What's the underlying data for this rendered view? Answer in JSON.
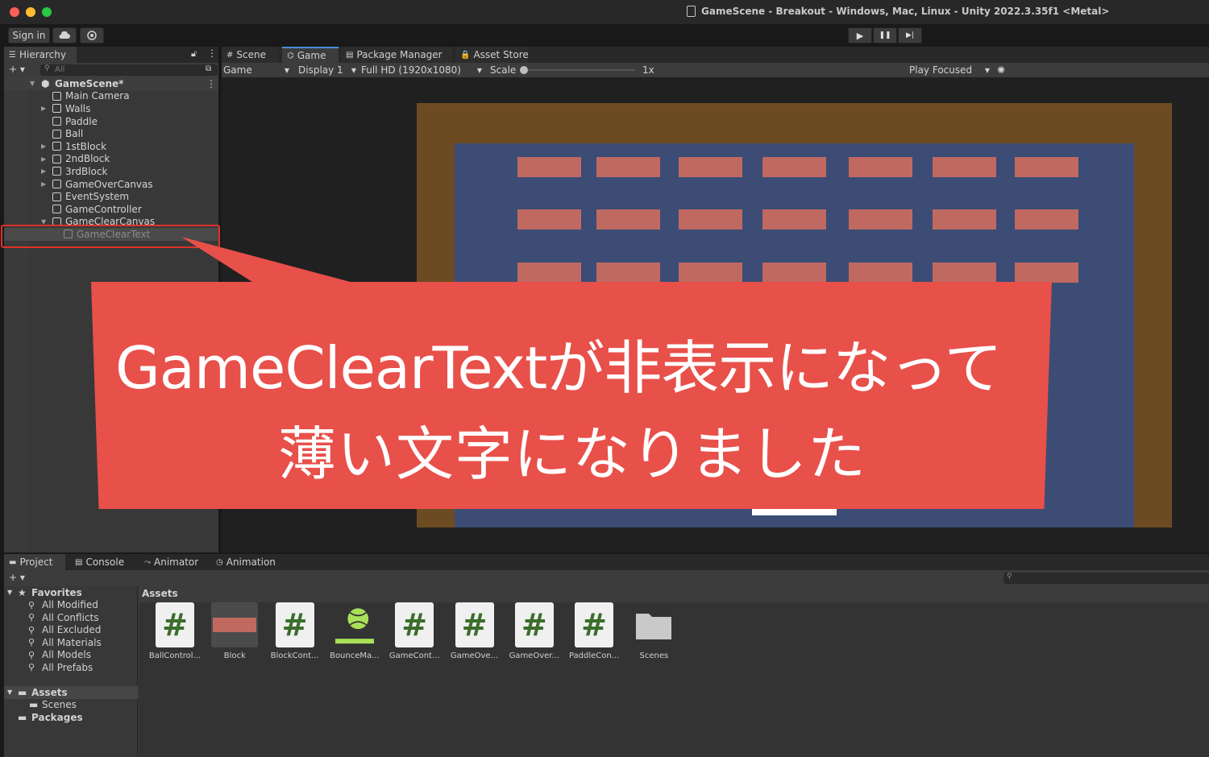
{
  "window": {
    "title": "GameScene - Breakout - Windows, Mac, Linux - Unity 2022.3.35f1 <Metal>"
  },
  "toolbar": {
    "sign_in_label": "Sign in",
    "cloud_icon": "cloud-icon",
    "collab_icon": "collab-icon",
    "play_icon": "▶",
    "pause_icon": "❚❚",
    "step_icon": "▶|"
  },
  "hierarchy": {
    "tab_label": "Hierarchy",
    "add_label": "+ ▾",
    "search_placeholder": "All",
    "scene_name": "GameScene*",
    "items": [
      {
        "label": "Main Camera",
        "expandable": false
      },
      {
        "label": "Walls",
        "expandable": true
      },
      {
        "label": "Paddle",
        "expandable": false
      },
      {
        "label": "Ball",
        "expandable": false
      },
      {
        "label": "1stBlock",
        "expandable": true
      },
      {
        "label": "2ndBlock",
        "expandable": true
      },
      {
        "label": "3rdBlock",
        "expandable": true
      },
      {
        "label": "GameOverCanvas",
        "expandable": true
      },
      {
        "label": "EventSystem",
        "expandable": false
      },
      {
        "label": "GameController",
        "expandable": false
      },
      {
        "label": "GameClearCanvas",
        "expandable": true,
        "expanded": true
      },
      {
        "label": "GameClearText",
        "expandable": false,
        "inactive": true,
        "highlighted": true
      }
    ]
  },
  "editor_tabs": [
    {
      "label": "Scene",
      "icon": "#"
    },
    {
      "label": "Game",
      "icon": "⌬",
      "active": true
    },
    {
      "label": "Package Manager",
      "icon": "▤"
    },
    {
      "label": "Asset Store",
      "icon": "🔒"
    }
  ],
  "game_toolbar": {
    "display_mode": "Game",
    "display": "Display 1",
    "resolution": "Full HD (1920x1080)",
    "scale_label": "Scale",
    "scale_value": "1x",
    "play_mode": "Play Focused"
  },
  "game": {
    "colors": {
      "wall": "#6d4b22",
      "field": "#3c4c75",
      "block": "#c06961",
      "paddle": "#ffffff"
    },
    "block_rows": 3,
    "block_cols": 7
  },
  "project_tabs": [
    {
      "label": "Project",
      "icon": "▬",
      "active": true
    },
    {
      "label": "Console",
      "icon": "▤"
    },
    {
      "label": "Animator",
      "icon": "⤳"
    },
    {
      "label": "Animation",
      "icon": "◷"
    }
  ],
  "project": {
    "favorites_label": "Favorites",
    "favorites": [
      "All Modified",
      "All Conflicts",
      "All Excluded",
      "All Materials",
      "All Models",
      "All Prefabs"
    ],
    "assets_label": "Assets",
    "assets_children": [
      "Scenes"
    ],
    "packages_label": "Packages",
    "breadcrumb": "Assets",
    "items": [
      {
        "name": "BallControl...",
        "kind": "script"
      },
      {
        "name": "Block",
        "kind": "prefab"
      },
      {
        "name": "BlockCont...",
        "kind": "script"
      },
      {
        "name": "BounceMa...",
        "kind": "physics-material"
      },
      {
        "name": "GameCont...",
        "kind": "script"
      },
      {
        "name": "GameOve...",
        "kind": "script"
      },
      {
        "name": "GameOver...",
        "kind": "script"
      },
      {
        "name": "PaddleCon...",
        "kind": "script"
      },
      {
        "name": "Scenes",
        "kind": "folder"
      }
    ]
  },
  "callout": {
    "line1": "GameClearTextが非表示になって",
    "line2": "薄い文字になりました",
    "color": "#e8504a"
  }
}
